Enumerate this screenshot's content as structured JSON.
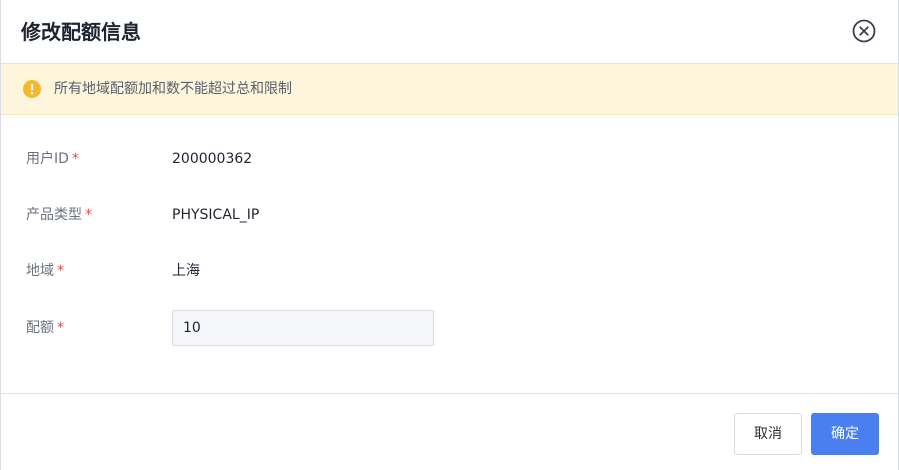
{
  "dialog": {
    "title": "修改配额信息"
  },
  "alert": {
    "message": "所有地域配额加和数不能超过总和限制"
  },
  "form": {
    "user_id": {
      "label": "用户ID",
      "required_mark": "*",
      "value": "200000362"
    },
    "product_type": {
      "label": "产品类型",
      "required_mark": "*",
      "value": "PHYSICAL_IP"
    },
    "region": {
      "label": "地域",
      "required_mark": "*",
      "value": "上海"
    },
    "quota": {
      "label": "配额",
      "required_mark": "*",
      "value": "10"
    }
  },
  "footer": {
    "cancel_label": "取消",
    "confirm_label": "确定"
  },
  "colors": {
    "primary": "#4a7ff0",
    "warning_bg": "#fdf6dc",
    "warning_icon": "#f5b82e",
    "required": "#e24a4a"
  },
  "icons": {
    "close": "close-circle-icon",
    "warning": "exclamation-circle-icon"
  }
}
